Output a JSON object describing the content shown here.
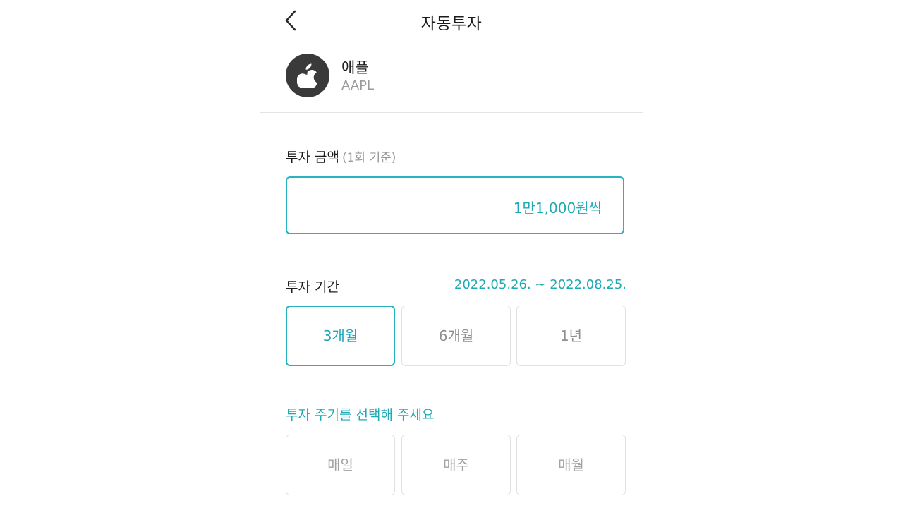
{
  "header": {
    "title": "자동투자"
  },
  "stock": {
    "name": "애플",
    "ticker": "AAPL",
    "logo_icon": "apple-logo-icon"
  },
  "amount": {
    "label": "투자 금액",
    "label_sub": "(1회 기준)",
    "value": "1만1,000원씩"
  },
  "period": {
    "label": "투자 기간",
    "date_range": "2022.05.26. ~ 2022.08.25.",
    "options": [
      {
        "label": "3개월",
        "selected": true
      },
      {
        "label": "6개월",
        "selected": false
      },
      {
        "label": "1년",
        "selected": false
      }
    ]
  },
  "cycle": {
    "prompt": "투자 주기를 선택해 주세요",
    "options": [
      {
        "label": "매일",
        "selected": false
      },
      {
        "label": "매주",
        "selected": false
      },
      {
        "label": "매월",
        "selected": false
      }
    ]
  },
  "colors": {
    "accent": "#1fa9b5",
    "accent_border": "#27b4bf",
    "text_primary": "#1c1c1c",
    "text_secondary": "#9a9a9a",
    "logo_bg": "#3a3a3a"
  }
}
